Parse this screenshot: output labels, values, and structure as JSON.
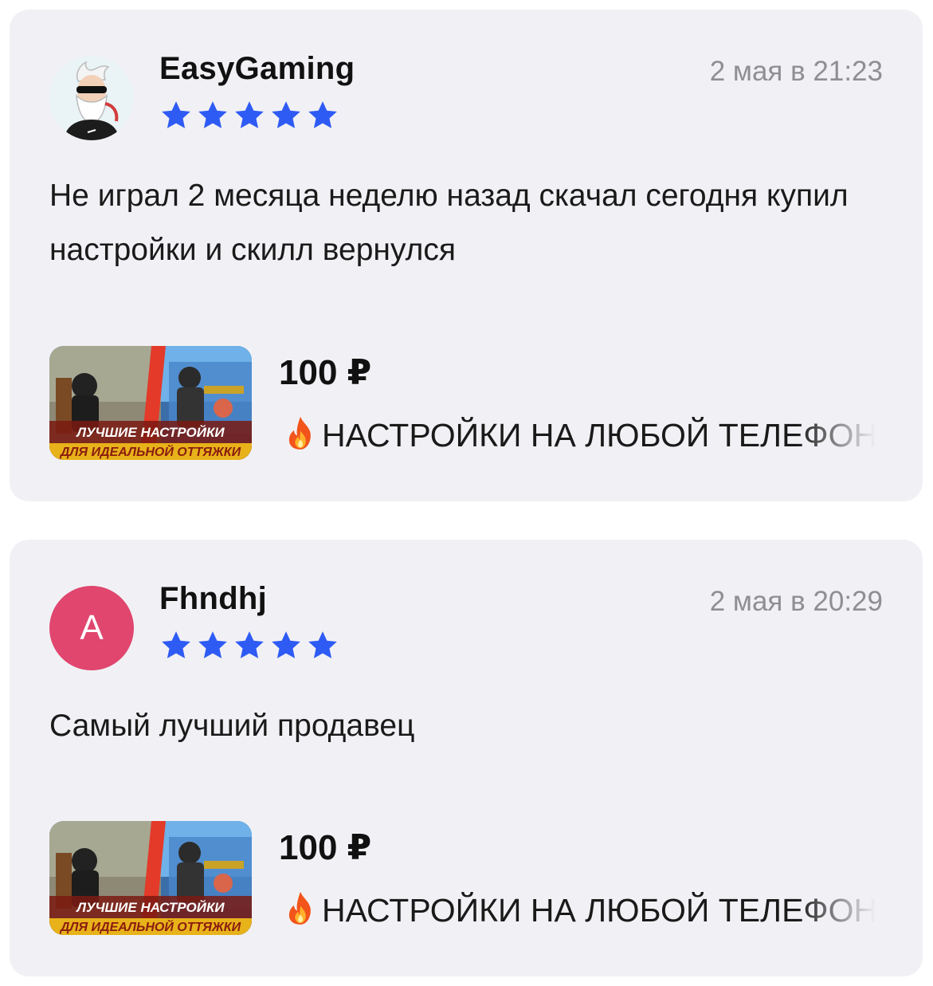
{
  "colors": {
    "card_background": "#f1f1f5",
    "star": "#2f5bf5",
    "date": "#8e8e93",
    "letter_avatar": "#e0466e"
  },
  "reviews": [
    {
      "author": "EasyGaming",
      "date": "2 мая в 21:23",
      "rating": 5,
      "avatar_icon": "bearded-man-sunglasses-avatar-icon",
      "text": "Не играл 2 месяца неделю назад скачал сегодня купил настройки и скилл вернулся",
      "product": {
        "price": "100 ₽",
        "title": "НАСТРОЙКИ НА ЛЮБОЙ ТЕЛЕФОН",
        "thumbnail_text_line1": "ЛУЧШИЕ НАСТРОЙКИ",
        "thumbnail_text_line2": "ДЛЯ ИДЕАЛЬНОЙ ОТТЯЖКИ"
      }
    },
    {
      "author": "Fhndhj",
      "date": "2 мая в 20:29",
      "rating": 5,
      "avatar_letter": "A",
      "text": "Самый лучший продавец",
      "product": {
        "price": "100 ₽",
        "title": "НАСТРОЙКИ НА ЛЮБОЙ ТЕЛЕФОН",
        "thumbnail_text_line1": "ЛУЧШИЕ НАСТРОЙКИ",
        "thumbnail_text_line2": "ДЛЯ ИДЕАЛЬНОЙ ОТТЯЖКИ"
      }
    }
  ]
}
